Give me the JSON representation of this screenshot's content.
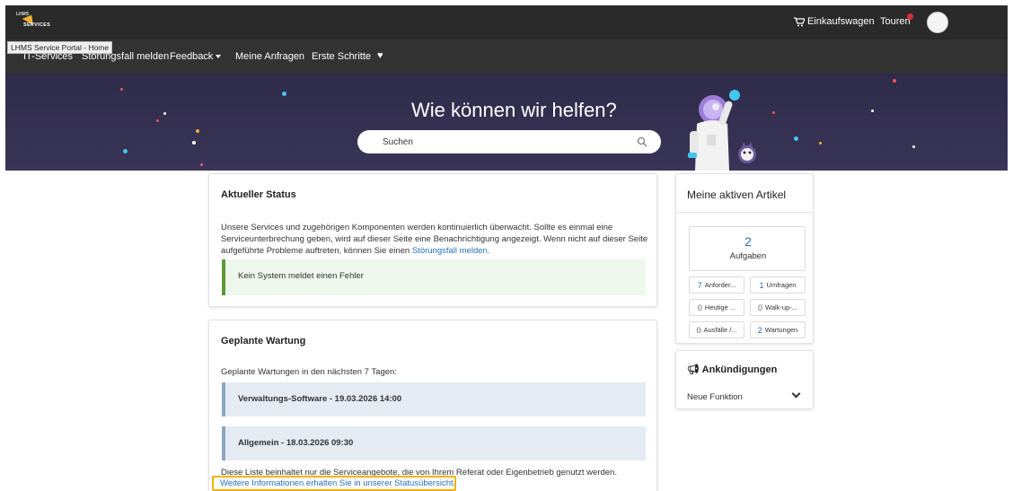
{
  "topbar": {
    "logo_small": "LHMS",
    "logo_big": "SERVICES",
    "cart_label": "Einkaufswagen",
    "tours_label": "Touren"
  },
  "tooltip": "LHMS Service Portal - Home",
  "nav": {
    "items": [
      "IT-Services",
      "Störungsfall melden",
      "Feedback",
      "Meine Anfragen",
      "Erste Schritte"
    ]
  },
  "hero": {
    "title": "Wie können wir helfen?",
    "search_placeholder": "Suchen"
  },
  "status_card": {
    "title": "Aktueller Status",
    "text_line1": "Unsere Services und zugehörigen Komponenten werden kontinuierlich überwacht. Sollte es einmal eine",
    "text_line2": "Serviceunterbrechung geben, wird auf dieser Seite eine Benachrichtigung angezeigt. Wenn nicht auf dieser Seite",
    "text_line3_prefix": "aufgeführte Probleme auftreten, können Sie einen",
    "text_line3_link": "Störungsfall melden.",
    "ok_message": "Kein System meldet einen Fehler"
  },
  "maintenance_card": {
    "title": "Geplante Wartung",
    "intro": "Geplante Wartungen in den nächsten 7 Tagen:",
    "items": [
      "Verwaltungs-Software - 19.03.2026 14:00",
      "Allgemein - 18.03.2026 09:30"
    ],
    "footer": "Diese Liste beinhaltet nur die Serviceangebote, die von Ihrem Referat oder Eigenbetrieb genutzt werden.",
    "footer_link": "Weitere Informationen erhalten Sie in unserer Statusübersicht."
  },
  "active_items": {
    "title": "Meine aktiven Artikel",
    "tasks_count": "2",
    "tasks_label": "Aufgaben",
    "tiles": [
      {
        "count": "7",
        "label": "Anforder..."
      },
      {
        "count": "1",
        "label": "Umfragen"
      },
      {
        "count": "0",
        "label": "Heutige ..."
      },
      {
        "count": "0",
        "label": "Walk-up-..."
      },
      {
        "count": "0",
        "label": "Ausfälle /..."
      },
      {
        "count": "2",
        "label": "Wartungen"
      }
    ]
  },
  "announcements": {
    "title": "Ankündigungen",
    "item": "Neue Funktion"
  },
  "colors": {
    "topbar": "#2a2a2a",
    "navbar": "#333333",
    "hero": "#2f2b49",
    "link": "#2b6fb6",
    "ok_border": "#5b9a35",
    "highlight": "#f4b400"
  }
}
